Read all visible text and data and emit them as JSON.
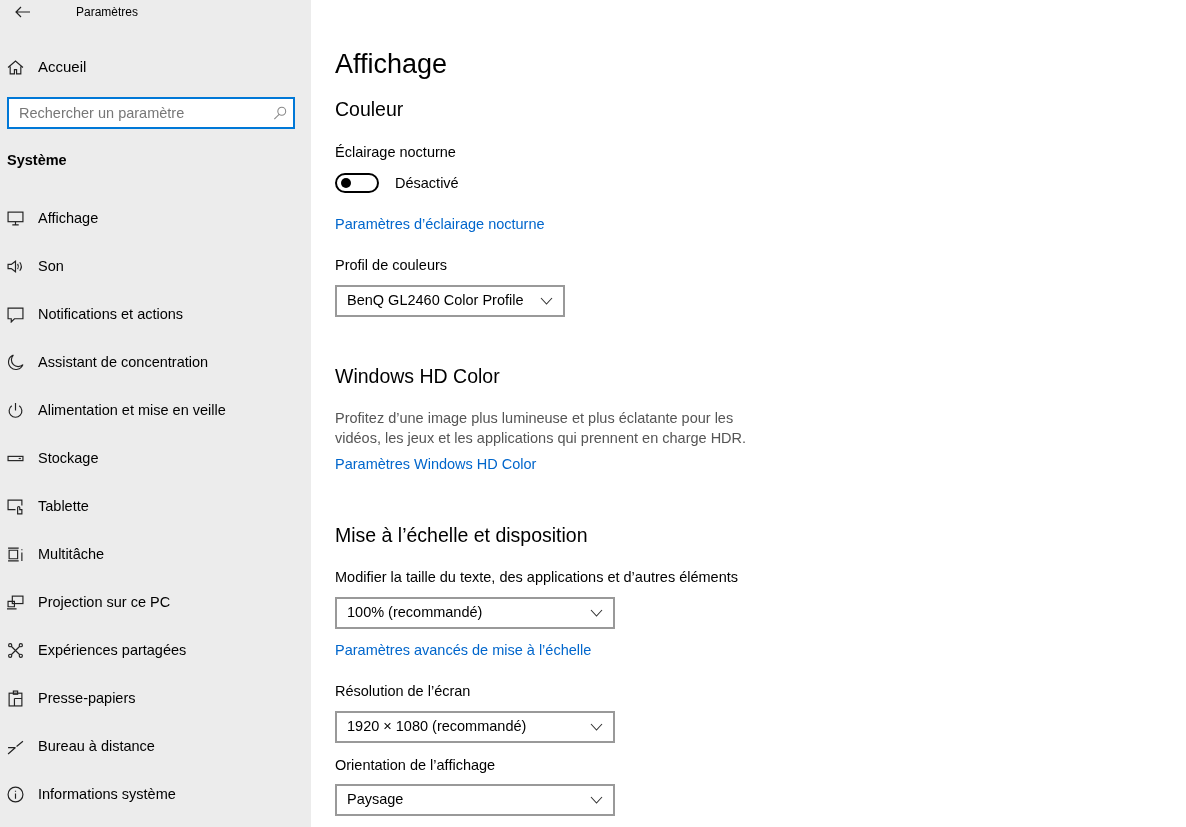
{
  "window": {
    "title": "Paramètres"
  },
  "sidebar": {
    "home": "Accueil",
    "search": {
      "placeholder": "Rechercher un paramètre"
    },
    "section": "Système",
    "items": [
      {
        "label": "Affichage"
      },
      {
        "label": "Son"
      },
      {
        "label": "Notifications et actions"
      },
      {
        "label": "Assistant de concentration"
      },
      {
        "label": "Alimentation et mise en veille"
      },
      {
        "label": "Stockage"
      },
      {
        "label": "Tablette"
      },
      {
        "label": "Multitâche"
      },
      {
        "label": "Projection sur ce PC"
      },
      {
        "label": "Expériences partagées"
      },
      {
        "label": "Presse-papiers"
      },
      {
        "label": "Bureau à distance"
      },
      {
        "label": "Informations système"
      }
    ]
  },
  "content": {
    "title": "Affichage",
    "items": [
      {
        "kind": "heading",
        "text": "Couleur"
      },
      {
        "kind": "label",
        "text": "Éclairage nocturne"
      },
      {
        "kind": "toggle",
        "on": false,
        "text": "Désactivé"
      },
      {
        "kind": "link",
        "text": "Paramètres d’éclairage nocturne"
      },
      {
        "kind": "label",
        "text": "Profil de couleurs"
      },
      {
        "kind": "dropdown",
        "text": "BenQ GL2460 Color Profile"
      },
      {
        "kind": "heading",
        "text": "Windows HD Color"
      },
      {
        "kind": "description",
        "text": "Profitez d’une image plus lumineuse et plus éclatante pour les vidéos, les jeux et les applications qui prennent en charge HDR."
      },
      {
        "kind": "link",
        "text": "Paramètres Windows HD Color"
      },
      {
        "kind": "heading",
        "text": "Mise à l’échelle et disposition"
      },
      {
        "kind": "label",
        "text": "Modifier la taille du texte, des applications et d’autres éléments"
      },
      {
        "kind": "dropdown",
        "text": "100% (recommandé)"
      },
      {
        "kind": "link",
        "text": "Paramètres avancés de mise à l’échelle"
      },
      {
        "kind": "label",
        "text": "Résolution de l’écran"
      },
      {
        "kind": "dropdown",
        "text": "1920 × 1080 (recommandé)"
      },
      {
        "kind": "label",
        "text": "Orientation de l’affichage"
      },
      {
        "kind": "dropdown",
        "text": "Paysage"
      }
    ]
  }
}
